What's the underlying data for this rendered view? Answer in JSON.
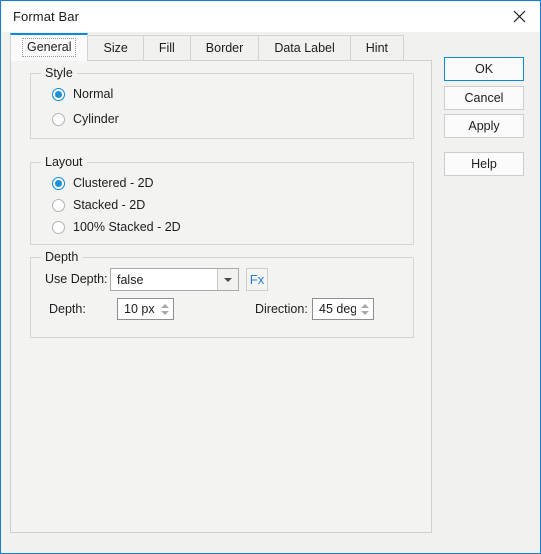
{
  "window": {
    "title": "Format Bar",
    "close_icon": "close-icon",
    "border_color": "#1a7ec8"
  },
  "tabs": [
    {
      "label": "General",
      "active": true
    },
    {
      "label": "Size",
      "active": false
    },
    {
      "label": "Fill",
      "active": false
    },
    {
      "label": "Border",
      "active": false
    },
    {
      "label": "Data Label",
      "active": false
    },
    {
      "label": "Hint",
      "active": false
    }
  ],
  "general": {
    "style": {
      "legend": "Style",
      "options": [
        {
          "label": "Normal",
          "selected": true
        },
        {
          "label": "Cylinder",
          "selected": false
        }
      ]
    },
    "layout": {
      "legend": "Layout",
      "options": [
        {
          "label": "Clustered - 2D",
          "selected": true
        },
        {
          "label": "Stacked - 2D",
          "selected": false
        },
        {
          "label": "100% Stacked - 2D",
          "selected": false
        }
      ]
    },
    "depth": {
      "legend": "Depth",
      "use_depth_label": "Use Depth:",
      "use_depth_value": "false",
      "use_depth_options": [
        "false",
        "true"
      ],
      "fx_label": "Fx",
      "depth_label": "Depth:",
      "depth_value": "10 px",
      "direction_label": "Direction:",
      "direction_value": "45 deg"
    }
  },
  "buttons": {
    "ok": "OK",
    "cancel": "Cancel",
    "apply": "Apply",
    "help": "Help"
  },
  "colors": {
    "accent": "#0a8ad8",
    "radio_fill": "#1e8fd5",
    "fx_text": "#2a7fd4",
    "panel_bg": "#f3f3f2",
    "dialog_bg": "#f1f1f0"
  }
}
